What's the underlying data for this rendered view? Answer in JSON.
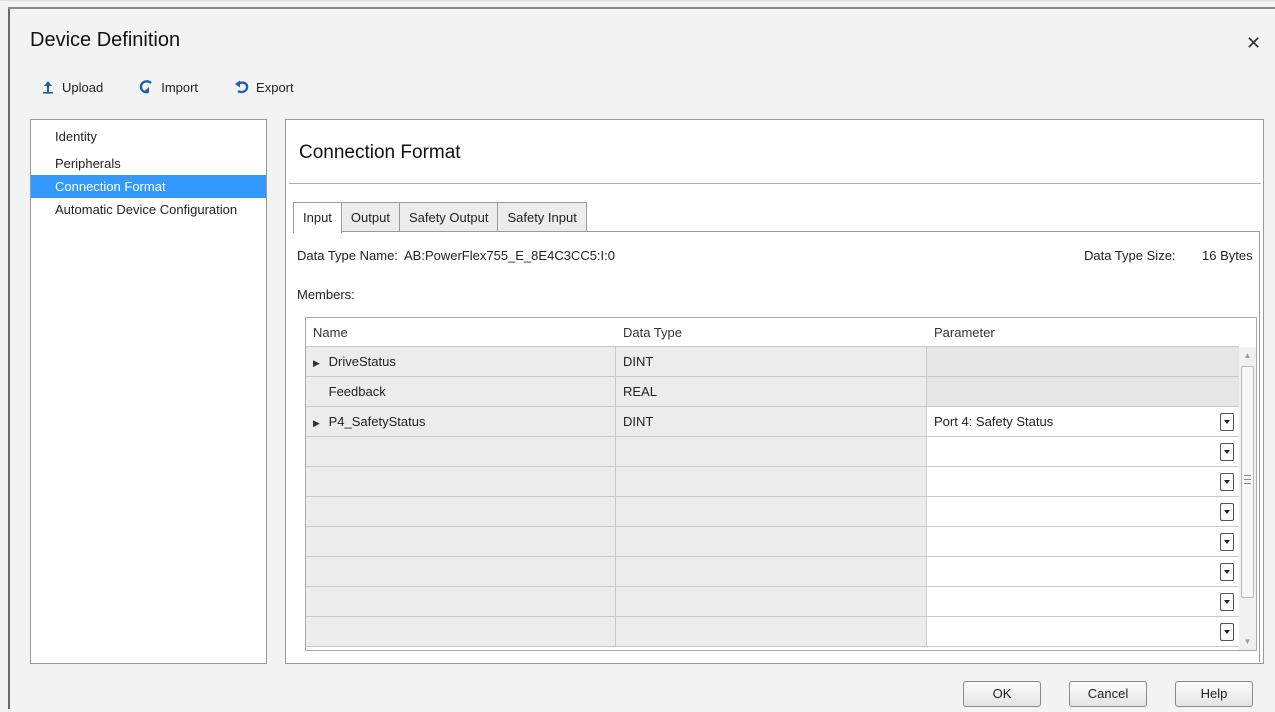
{
  "dialog": {
    "title": "Device Definition",
    "close_glyph": "✕"
  },
  "toolbar": {
    "upload": {
      "label": "Upload",
      "icon": "upload-arrow-icon"
    },
    "import": {
      "label": "Import",
      "icon": "import-icon"
    },
    "export": {
      "label": "Export",
      "icon": "export-icon"
    }
  },
  "sidebar": {
    "items": [
      {
        "label": "Identity"
      },
      {
        "label": "Peripherals"
      },
      {
        "label": "Connection Format",
        "selected": true
      },
      {
        "label": "Automatic Device Configuration"
      }
    ]
  },
  "main": {
    "title": "Connection Format",
    "tabs": [
      {
        "label": "Input",
        "active": true
      },
      {
        "label": "Output"
      },
      {
        "label": "Safety Output"
      },
      {
        "label": "Safety Input"
      }
    ],
    "data_type_name_label": "Data Type Name:",
    "data_type_name_value": "AB:PowerFlex755_E_8E4C3CC5:I:0",
    "data_type_size_label": "Data Type Size:",
    "data_type_size_value": "16 Bytes",
    "members_label": "Members:"
  },
  "grid": {
    "columns": [
      "Name",
      "Data Type",
      "Parameter"
    ],
    "rows": [
      {
        "name": "DriveStatus",
        "type": "DINT",
        "parameter": "",
        "expandable": true,
        "param_enabled": false
      },
      {
        "name": "Feedback",
        "type": "REAL",
        "parameter": "",
        "expandable": false,
        "param_enabled": false
      },
      {
        "name": "P4_SafetyStatus",
        "type": "DINT",
        "parameter": "Port 4: Safety Status",
        "expandable": true,
        "param_enabled": true
      },
      {
        "name": "",
        "type": "",
        "parameter": "",
        "expandable": false,
        "param_enabled": true
      },
      {
        "name": "",
        "type": "",
        "parameter": "",
        "expandable": false,
        "param_enabled": true
      },
      {
        "name": "",
        "type": "",
        "parameter": "",
        "expandable": false,
        "param_enabled": true
      },
      {
        "name": "",
        "type": "",
        "parameter": "",
        "expandable": false,
        "param_enabled": true
      },
      {
        "name": "",
        "type": "",
        "parameter": "",
        "expandable": false,
        "param_enabled": true
      },
      {
        "name": "",
        "type": "",
        "parameter": "",
        "expandable": false,
        "param_enabled": true
      },
      {
        "name": "",
        "type": "",
        "parameter": "",
        "expandable": false,
        "param_enabled": true
      }
    ]
  },
  "footer": {
    "ok_label": "OK",
    "cancel_label": "Cancel",
    "help_label": "Help"
  },
  "colors": {
    "selection": "#3399ff",
    "toolbar_icon": "#1f5fa8",
    "dialog_bg": "#f3f3f3"
  }
}
